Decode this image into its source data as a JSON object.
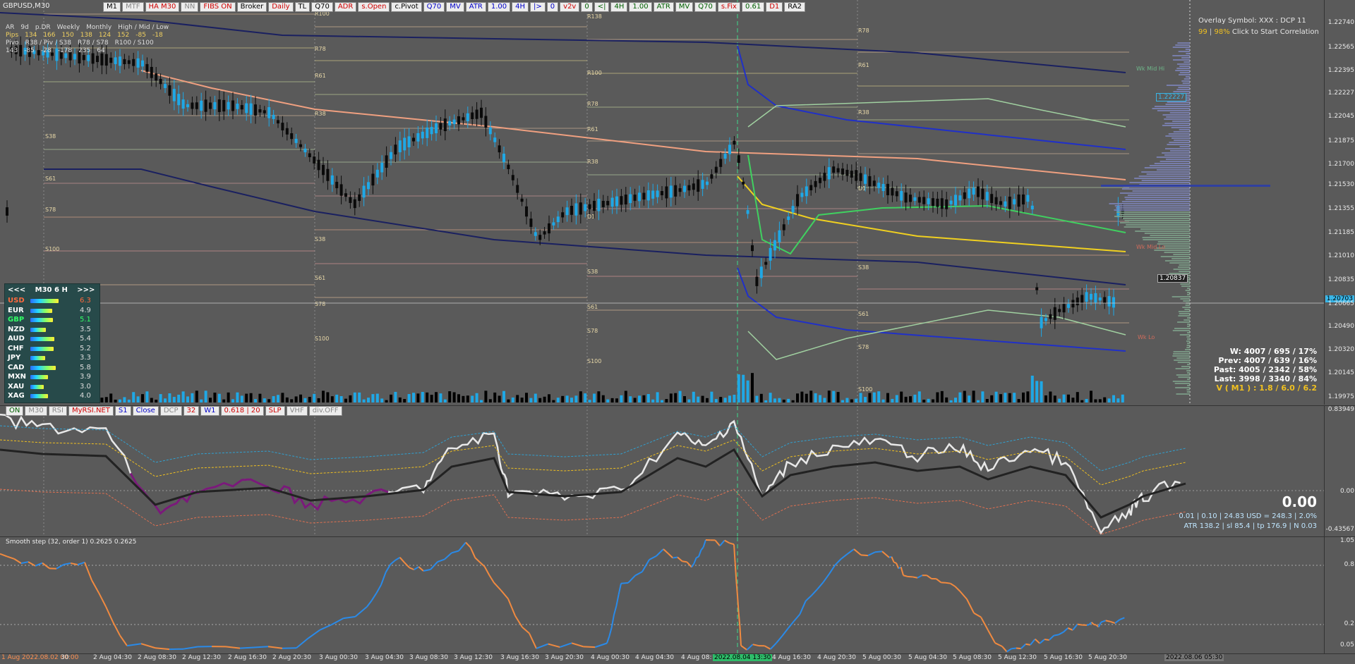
{
  "symbol": "GBPUSD,M30",
  "top_toolbar": [
    "M1",
    "MTF",
    "HA M30",
    "NN",
    "FIBS ON",
    "Broker",
    "Daily",
    "TL",
    "Q70",
    "ADR",
    "s.Open",
    "c.Pivot",
    "Q70",
    "MV",
    "ATR",
    "1.00",
    "4H",
    "|>",
    "0",
    "v2v",
    "0",
    "<|",
    "4H",
    "1.00",
    "ATR",
    "MV",
    "Q70",
    "s.Fix",
    "0.61",
    "D1",
    "RA2"
  ],
  "top_toolbar_colors": [
    "#000",
    "#888",
    "#d00000",
    "#888",
    "#d00000",
    "#000",
    "#d00000",
    "#000",
    "#000",
    "#d00000",
    "#d00000",
    "#000",
    "#0000c8",
    "#0000c8",
    "#0000c8",
    "#0000c8",
    "#0000c8",
    "#0000c8",
    "#0000c8",
    "#d00000",
    "#006000",
    "#006000",
    "#006000",
    "#006000",
    "#006000",
    "#006000",
    "#006000",
    "#d00000",
    "#006000",
    "#d00000",
    "#000"
  ],
  "adr_table": {
    "row1": [
      "AR",
      "9d",
      "p.DR",
      "Weekly",
      "Monthly",
      "High / Mid / Low"
    ],
    "row2": [
      "Pips",
      "134",
      "166",
      "150",
      "138",
      "124",
      "152",
      "-85",
      "-18"
    ],
    "row3": [
      "Pivo",
      "R38 / Piv / S38",
      "R78 / S78",
      "R100 / S100"
    ],
    "row4": [
      "143",
      "-85",
      "-28",
      "-178",
      "235",
      "64"
    ]
  },
  "overlay": {
    "line1": "Overlay Symbol: XXX : DCP 11",
    "line2_a": "99",
    "line2_b": "98%",
    "line2_c": "Click to Start Correlation"
  },
  "price_axis": [
    "1.22740",
    "1.22565",
    "1.22395",
    "1.22227",
    "1.22045",
    "1.21875",
    "1.21700",
    "1.21530",
    "1.21355",
    "1.21185",
    "1.21010",
    "1.20835",
    "1.20703",
    "1.20665",
    "1.20490",
    "1.20320",
    "1.20145",
    "1.19975"
  ],
  "price_boxes": {
    "p1": "1.22227",
    "p2": "1.20837",
    "current": "1.20703"
  },
  "stats": {
    "w": "W: 4007 / 695 / 17%",
    "prev": "Prev: 4007 / 639 / 16%",
    "past": "Past: 4005 / 2342 / 58%",
    "last": "Last: 3998 / 3340 / 84%",
    "v": "V ( M1 ) : 1.8 / 6.0 / 6.2"
  },
  "levels_right": [
    "Wk Mid Hi",
    "Wk Mid Lo",
    "Wk Lo"
  ],
  "currency_panel": {
    "header": [
      "<<<",
      "M30",
      "6",
      "H",
      ">>>"
    ],
    "rows": [
      {
        "name": "USD",
        "value": "6.3",
        "color": "#ff6a3d"
      },
      {
        "name": "EUR",
        "value": "4.9",
        "color": "#ffffff"
      },
      {
        "name": "GBP",
        "value": "5.1",
        "color": "#33ff66"
      },
      {
        "name": "NZD",
        "value": "3.5",
        "color": "#ffffff"
      },
      {
        "name": "AUD",
        "value": "5.4",
        "color": "#ffffff"
      },
      {
        "name": "CHF",
        "value": "5.2",
        "color": "#ffffff"
      },
      {
        "name": "JPY",
        "value": "3.3",
        "color": "#ffffff"
      },
      {
        "name": "CAD",
        "value": "5.8",
        "color": "#ffffff"
      },
      {
        "name": "MXN",
        "value": "3.9",
        "color": "#ffffff"
      },
      {
        "name": "XAU",
        "value": "3.0",
        "color": "#ffffff"
      },
      {
        "name": "XAG",
        "value": "4.0",
        "color": "#ffffff"
      }
    ]
  },
  "rsi_toolbar": [
    "ON",
    "M30",
    "RSI",
    "MyRSI.NET",
    "S1",
    "Close",
    "DCP",
    "32",
    "W1",
    "0.618 | 20",
    "SLP",
    "VHF",
    "div.OFF"
  ],
  "rsi_toolbar_colors": [
    "#006000",
    "#888",
    "#888",
    "#d00000",
    "#0000c8",
    "#0000c8",
    "#888",
    "#d00000",
    "#0000c8",
    "#d00000",
    "#d00000",
    "#888",
    "#888"
  ],
  "rsi_axis": [
    "0.83949",
    "0.00",
    "-0.43567"
  ],
  "rsi_info": {
    "big": "0.00",
    "line1": "0.01  |  0.10  |  24.83 USD = 248.3  |  2.0%",
    "line2": "ATR 138.2  |  sl 85.4  |  tp 176.9  |  N 0.03"
  },
  "smooth_title": "Smooth step (32, order 1) 0.2625 0.2625",
  "smooth_axis": [
    "1.05",
    "0.8",
    "0.2",
    "0.05"
  ],
  "dates": [
    "1 Aug 2022.08.02 00:00",
    "30",
    "2 Aug 04:30",
    "2 Aug 08:30",
    "2 Aug 12:30",
    "2 Aug 16:30",
    "2 Aug 20:30",
    "3 Aug 00:30",
    "3 Aug 04:30",
    "3 Aug 08:30",
    "3 Aug 12:30",
    "3 Aug 16:30",
    "3 Aug 20:30",
    "4 Aug 00:30",
    "4 Aug 04:30",
    "4 Aug 08:",
    "2022.08.04 13:30",
    "4 Aug 16:30",
    "4 Aug 20:30",
    "5 Aug 00:30",
    "5 Aug 04:30",
    "5 Aug 08:30",
    "5 Aug 12:30",
    "5 Aug 16:30",
    "5 Aug 20:30",
    "2022.08.06 05:30"
  ],
  "fib_labels": [
    "R100",
    "R78",
    "R61",
    "R38",
    "S38",
    "S61",
    "S78",
    "S100",
    "D1",
    "R138"
  ]
}
